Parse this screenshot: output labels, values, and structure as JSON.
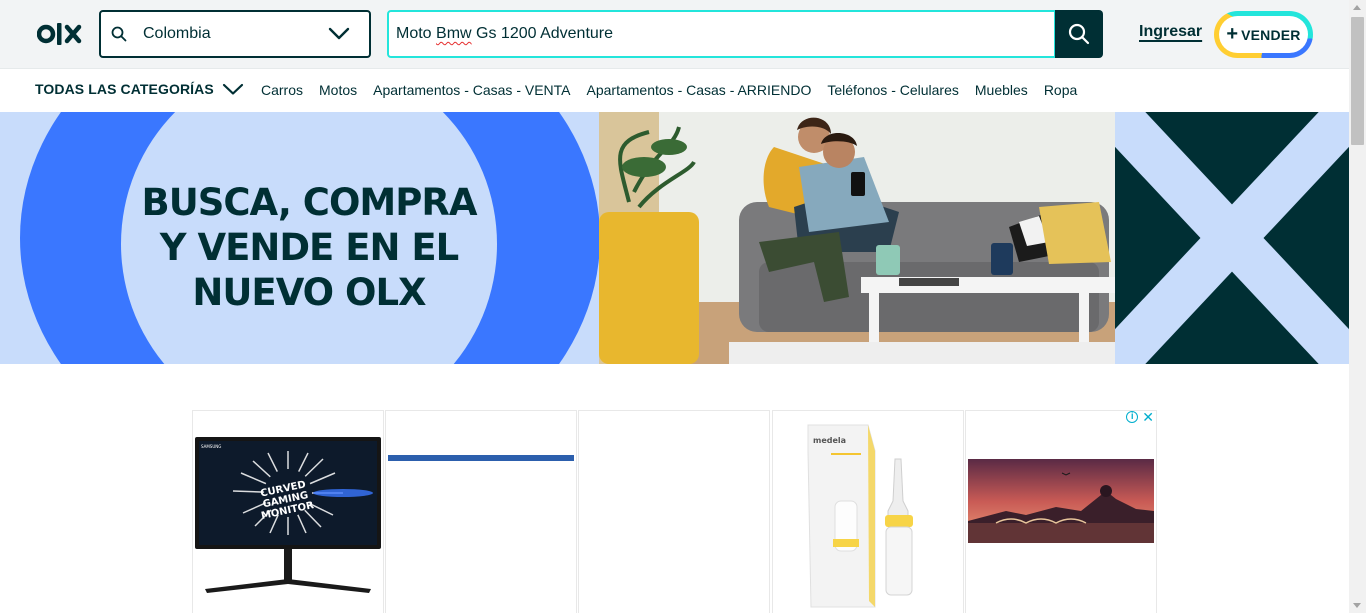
{
  "header": {
    "logo_text": "olx",
    "location": {
      "value": "Colombia"
    },
    "search": {
      "query_before": "Moto ",
      "query_misspelled": "Bmw",
      "query_after": " Gs 1200 Adventure"
    },
    "login_label": "Ingresar",
    "sell_label": "VENDER"
  },
  "categories": {
    "all_label": "TODAS LAS CATEGORÍAS",
    "links": [
      "Carros",
      "Motos",
      "Apartamentos - Casas - VENTA",
      "Apartamentos - Casas - ARRIENDO",
      "Teléfonos - Celulares",
      "Muebles",
      "Ropa"
    ]
  },
  "banner": {
    "headline_line1": "BUSCA, COMPRA",
    "headline_line2": "Y VENDE EN EL",
    "headline_line3": "NUEVO OLX"
  },
  "ads": {
    "monitor_brand": "SAMSUNG",
    "monitor_text_1": "CURVED",
    "monitor_text_2": "GAMING",
    "monitor_text_3": "MONITOR",
    "product_brand": "medela",
    "info_icon": "i",
    "close_icon": "✕"
  },
  "colors": {
    "brand_dark": "#002f34",
    "accent_teal": "#23e5db",
    "accent_blue": "#3a77ff",
    "accent_yellow": "#ffce32",
    "banner_light_blue": "#c8dcfb"
  }
}
